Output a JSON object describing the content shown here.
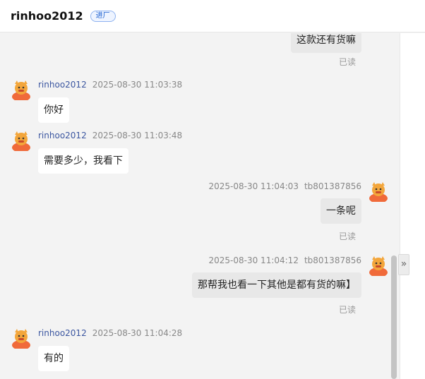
{
  "header": {
    "title": "rinhoo2012",
    "tag": "进厂"
  },
  "messages": [
    {
      "side": "right",
      "text": "这款还有货嘛",
      "read": "已读"
    },
    {
      "side": "left",
      "name": "rinhoo2012",
      "time": "2025-08-30 11:03:38",
      "text": "你好"
    },
    {
      "side": "left",
      "name": "rinhoo2012",
      "time": "2025-08-30 11:03:48",
      "text": "需要多少，我看下"
    },
    {
      "side": "right",
      "name": "tb801387856",
      "time": "2025-08-30 11:04:03",
      "text": "一条呢",
      "read": "已读"
    },
    {
      "side": "right",
      "name": "tb801387856",
      "time": "2025-08-30 11:04:12",
      "text": "那帮我也看一下其他是都有货的嘛】",
      "read": "已读"
    },
    {
      "side": "left",
      "name": "rinhoo2012",
      "time": "2025-08-30 11:04:28",
      "text": "有的"
    }
  ],
  "panel": {
    "collapse_glyph": "»"
  },
  "colors": {
    "avatar_body": "#f06a3a",
    "avatar_face": "#f3a63b",
    "tag_accent": "#1a5fd0"
  }
}
